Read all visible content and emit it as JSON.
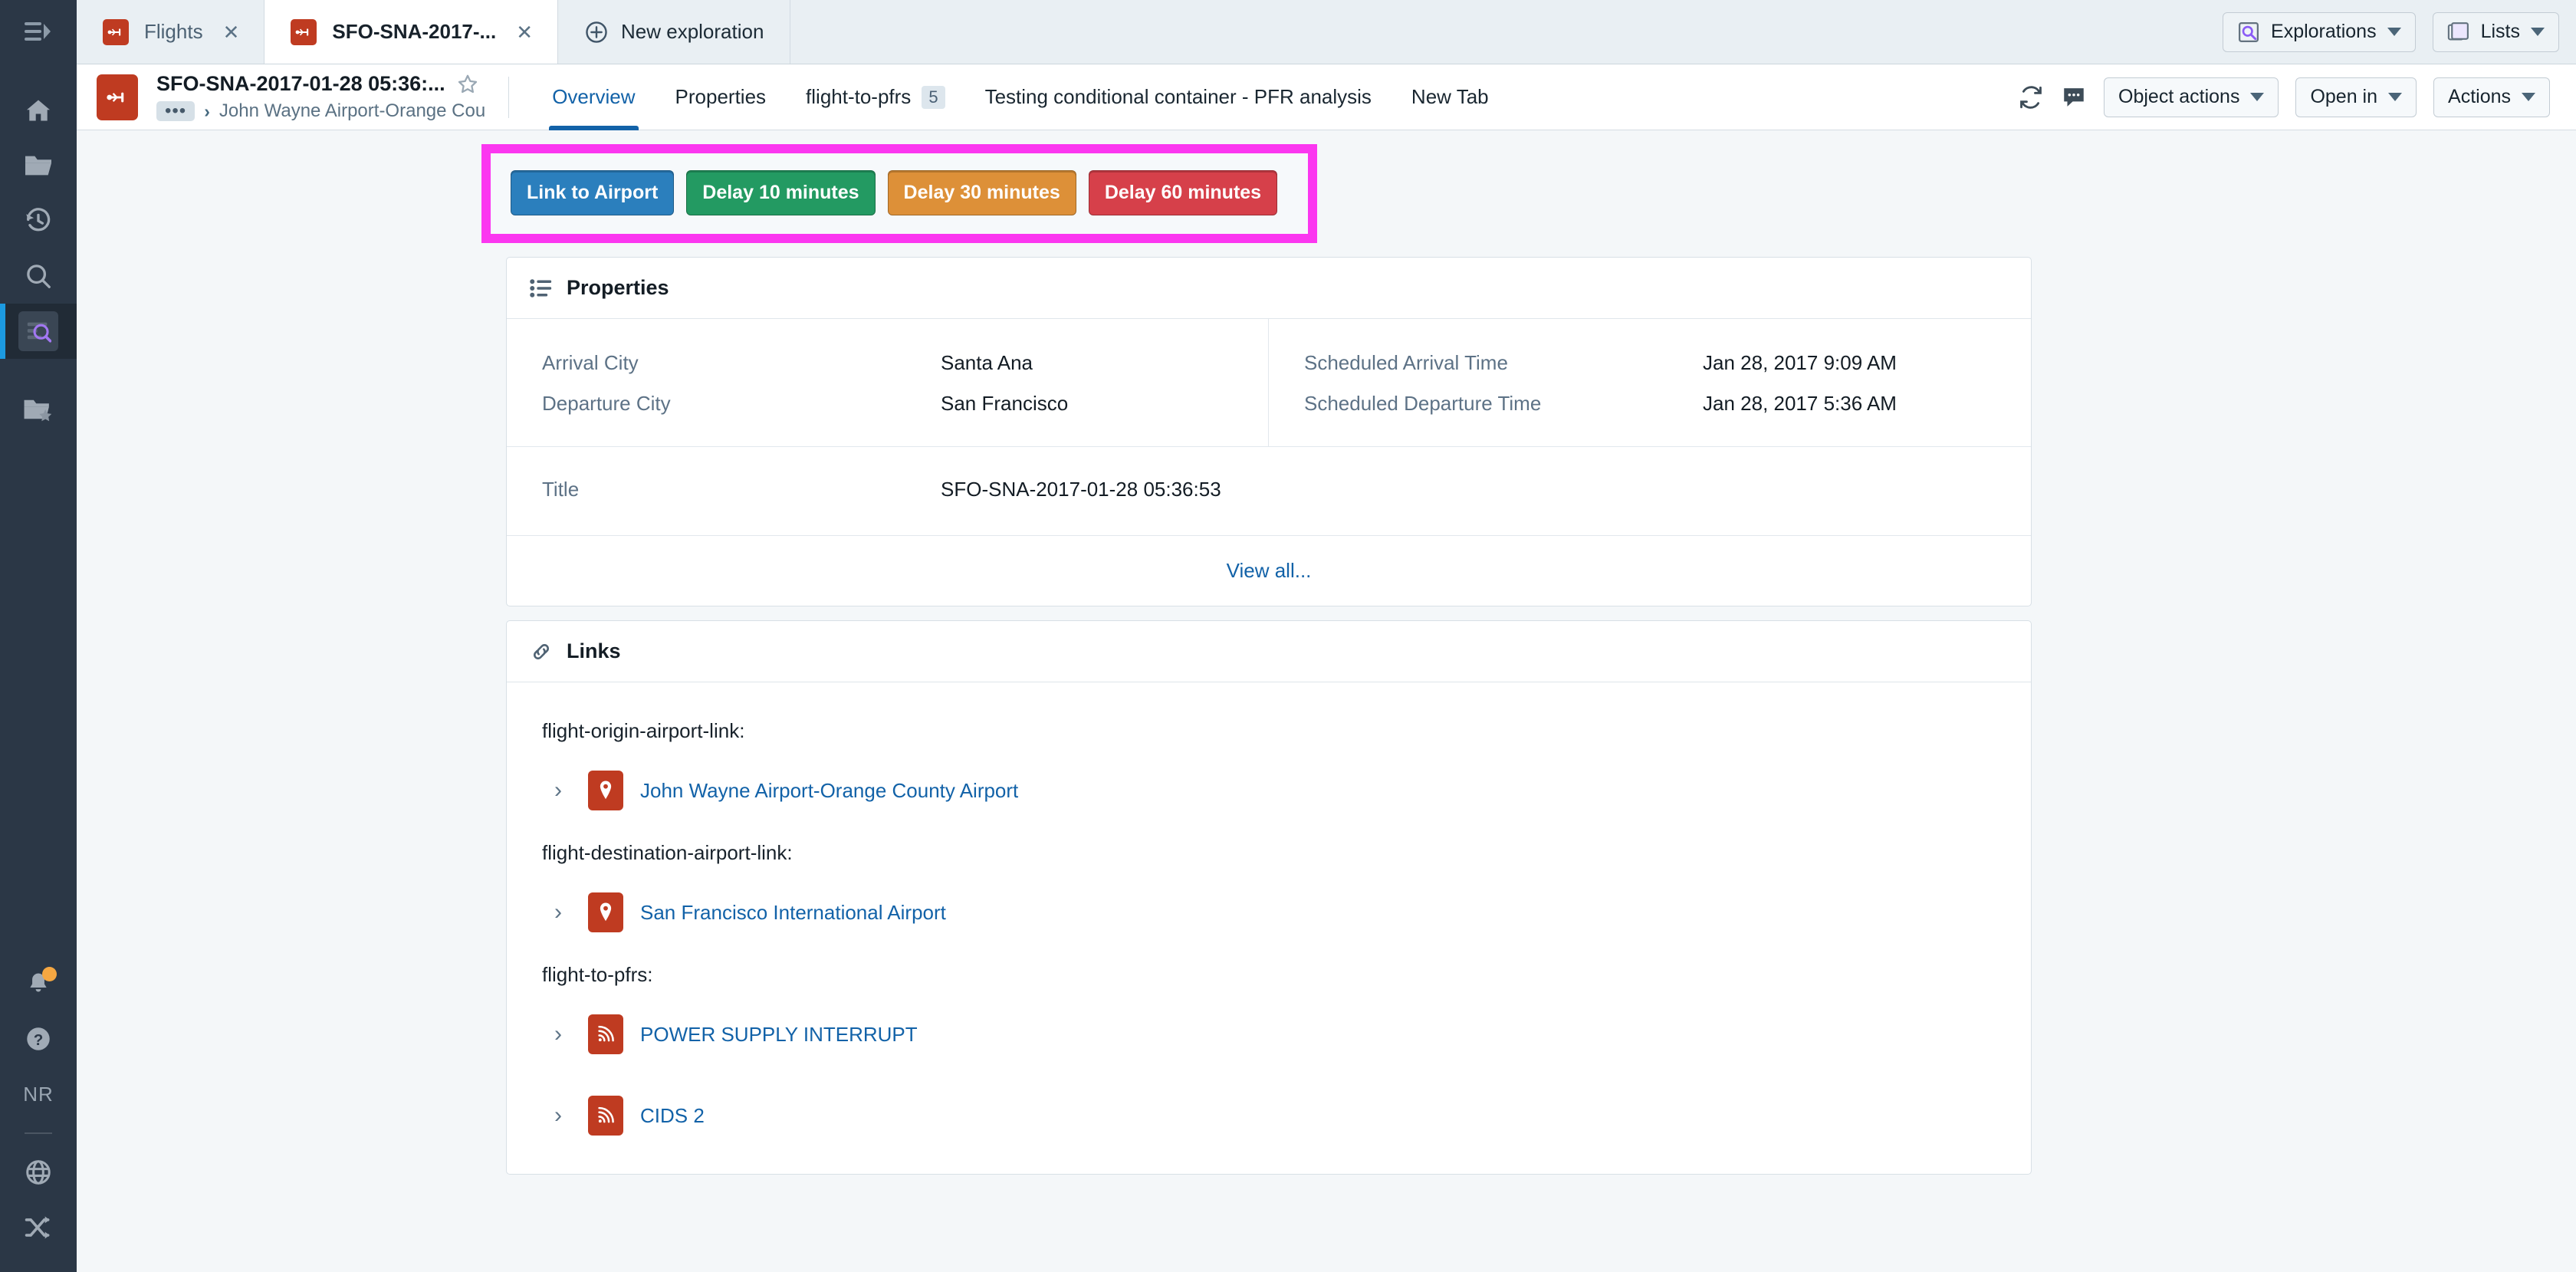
{
  "browser_tabs": [
    {
      "label": "Flights",
      "active": false,
      "icon": "flight-object-icon",
      "close": "✕"
    },
    {
      "label": "SFO-SNA-2017-...",
      "active": true,
      "icon": "flight-object-icon",
      "close": "✕"
    }
  ],
  "new_exploration": {
    "label": "New exploration",
    "icon": "plus-circle-icon"
  },
  "tabstrip_right": [
    {
      "label": "Explorations",
      "icon": "exploration-search-icon"
    },
    {
      "label": "Lists",
      "icon": "lists-stack-icon"
    }
  ],
  "header": {
    "object_icon": "flight-object-icon",
    "title": "SFO-SNA-2017-01-28 05:36:...",
    "favorite_icon": "star-outline-icon",
    "breadcrumb": {
      "ellipsis": "•••",
      "separator": "›",
      "text": "John Wayne Airport-Orange Cou"
    },
    "tabs": [
      {
        "label": "Overview",
        "active": true,
        "count": null
      },
      {
        "label": "Properties",
        "active": false,
        "count": null
      },
      {
        "label": "flight-to-pfrs",
        "active": false,
        "count": "5"
      },
      {
        "label": "Testing conditional container - PFR analysis",
        "active": false,
        "count": null
      },
      {
        "label": "New Tab",
        "active": false,
        "count": null
      }
    ],
    "refresh_icon": "refresh-icon",
    "comment_icon": "comment-icon",
    "buttons": [
      {
        "label": "Object actions"
      },
      {
        "label": "Open in"
      },
      {
        "label": "Actions"
      }
    ]
  },
  "highlight": {
    "border_color": "#fb37f0",
    "actions": [
      {
        "label": "Link to Airport",
        "color": "#2b7fbd"
      },
      {
        "label": "Delay 10 minutes",
        "color": "#239a62"
      },
      {
        "label": "Delay 30 minutes",
        "color": "#dd9038"
      },
      {
        "label": "Delay 60 minutes",
        "color": "#d6404a"
      }
    ]
  },
  "properties_card": {
    "title": "Properties",
    "icon": "list-icon",
    "left_rows": [
      {
        "key": "Arrival City",
        "value": "Santa Ana"
      },
      {
        "key": "Departure City",
        "value": "San Francisco"
      }
    ],
    "right_rows": [
      {
        "key": "Scheduled Arrival Time",
        "value": "Jan 28, 2017 9:09 AM"
      },
      {
        "key": "Scheduled Departure Time",
        "value": "Jan 28, 2017 5:36 AM"
      }
    ],
    "full_rows": [
      {
        "key": "Title",
        "value": "SFO-SNA-2017-01-28 05:36:53"
      }
    ],
    "view_all": "View all..."
  },
  "links_card": {
    "title": "Links",
    "icon": "chain-link-icon",
    "groups": [
      {
        "label": "flight-origin-airport-link:",
        "items": [
          {
            "name": "John Wayne Airport-Orange County Airport",
            "icon": "map-pin-icon",
            "chevron": "›"
          }
        ]
      },
      {
        "label": "flight-destination-airport-link:",
        "items": [
          {
            "name": "San Francisco International Airport",
            "icon": "map-pin-icon",
            "chevron": "›"
          }
        ]
      },
      {
        "label": "flight-to-pfrs:",
        "items": [
          {
            "name": "POWER SUPPLY INTERRUPT",
            "icon": "signal-icon",
            "chevron": "›"
          },
          {
            "name": "CIDS 2",
            "icon": "signal-icon",
            "chevron": "›"
          }
        ]
      }
    ]
  },
  "rail": {
    "toggle_icon": "collapse-sidebar-icon",
    "top_items": [
      {
        "icon": "home-icon",
        "active": false
      },
      {
        "icon": "folder-icon",
        "active": false
      },
      {
        "icon": "history-icon",
        "active": false
      },
      {
        "icon": "search-icon",
        "active": false
      },
      {
        "icon": "explorations-icon",
        "active": true
      },
      {
        "icon": "folder-star-icon",
        "active": false
      }
    ],
    "bottom_items": [
      {
        "icon": "notification-bell-icon",
        "badge": true
      },
      {
        "icon": "help-icon"
      },
      {
        "initials": "NR"
      },
      {
        "icon": "globe-icon"
      },
      {
        "icon": "shuffle-icon"
      }
    ]
  }
}
